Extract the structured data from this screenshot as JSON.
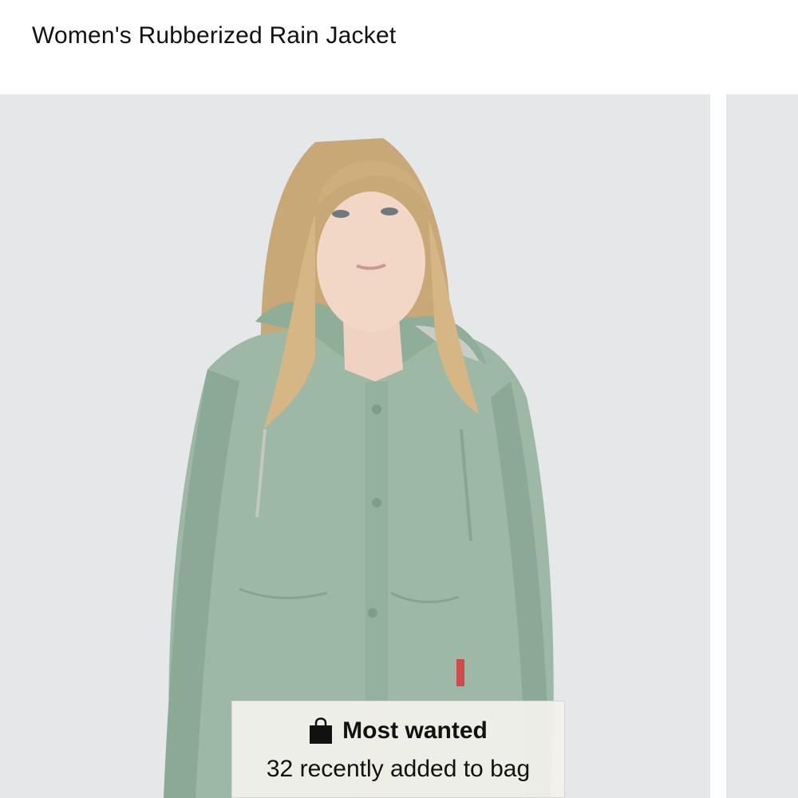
{
  "product": {
    "title": "Women's Rubberized Rain Jacket"
  },
  "badge": {
    "icon": "shopping-bag-icon",
    "title": "Most wanted",
    "subtitle": "32 recently added to bag"
  },
  "colors": {
    "background": "#e6e7e8",
    "jacket": "#9db9a6",
    "badge_bg": "#f3f1ec"
  }
}
